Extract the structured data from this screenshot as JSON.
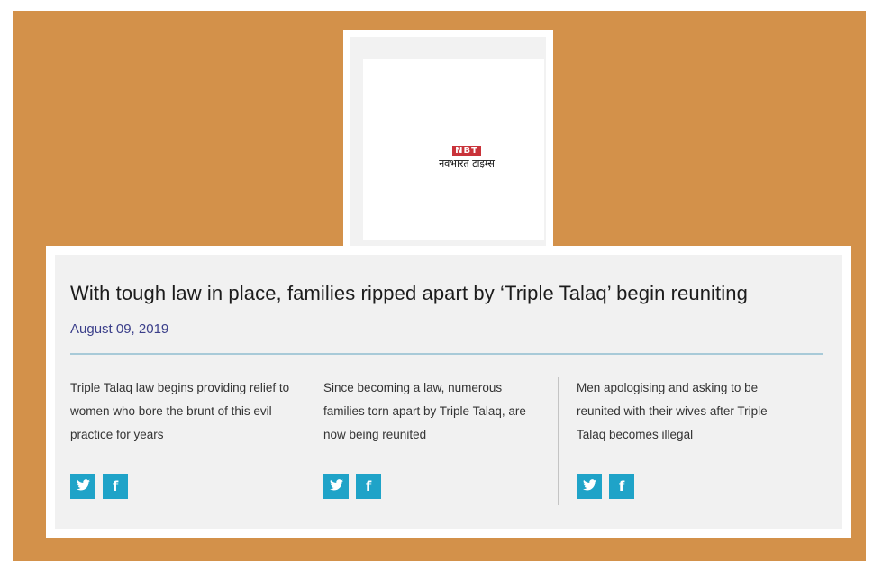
{
  "logo": {
    "abbr": "NBT",
    "name": "नवभारत टाइम्स"
  },
  "article": {
    "headline": "With tough law in place, families ripped apart by ‘Triple Talaq’ begin reuniting",
    "date": "August 09, 2019"
  },
  "columns": [
    {
      "text": "Triple Talaq law begins providing relief to women who bore the brunt of this evil practice for years",
      "share": {
        "twitter_icon": "twitter-icon",
        "facebook_icon": "facebook-icon"
      }
    },
    {
      "text": "Since becoming a law, numerous families torn apart by Triple Talaq, are now being reunited",
      "share": {
        "twitter_icon": "twitter-icon",
        "facebook_icon": "facebook-icon"
      }
    },
    {
      "text": "Men apologising and asking to be reunited with their wives after Triple Talaq becomes illegal",
      "share": {
        "twitter_icon": "twitter-icon",
        "facebook_icon": "facebook-icon"
      }
    }
  ],
  "colors": {
    "background": "#d3914a",
    "date": "#3b3f8a",
    "share_button": "#1fa3c8",
    "rule": "#a8cad8",
    "logo_red": "#c9333a"
  }
}
